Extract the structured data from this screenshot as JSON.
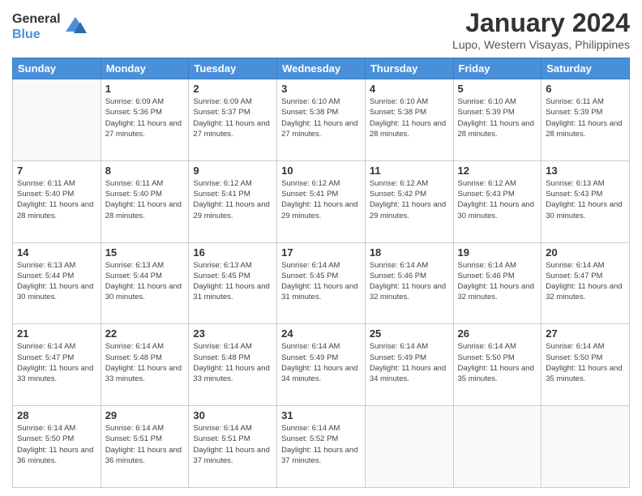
{
  "header": {
    "logo_line1": "General",
    "logo_line2": "Blue",
    "title": "January 2024",
    "subtitle": "Lupo, Western Visayas, Philippines"
  },
  "days_of_week": [
    "Sunday",
    "Monday",
    "Tuesday",
    "Wednesday",
    "Thursday",
    "Friday",
    "Saturday"
  ],
  "weeks": [
    [
      {
        "day": "",
        "sunrise": "",
        "sunset": "",
        "daylight": ""
      },
      {
        "day": "1",
        "sunrise": "6:09 AM",
        "sunset": "5:36 PM",
        "daylight": "11 hours and 27 minutes."
      },
      {
        "day": "2",
        "sunrise": "6:09 AM",
        "sunset": "5:37 PM",
        "daylight": "11 hours and 27 minutes."
      },
      {
        "day": "3",
        "sunrise": "6:10 AM",
        "sunset": "5:38 PM",
        "daylight": "11 hours and 27 minutes."
      },
      {
        "day": "4",
        "sunrise": "6:10 AM",
        "sunset": "5:38 PM",
        "daylight": "11 hours and 28 minutes."
      },
      {
        "day": "5",
        "sunrise": "6:10 AM",
        "sunset": "5:39 PM",
        "daylight": "11 hours and 28 minutes."
      },
      {
        "day": "6",
        "sunrise": "6:11 AM",
        "sunset": "5:39 PM",
        "daylight": "11 hours and 28 minutes."
      }
    ],
    [
      {
        "day": "7",
        "sunrise": "6:11 AM",
        "sunset": "5:40 PM",
        "daylight": "11 hours and 28 minutes."
      },
      {
        "day": "8",
        "sunrise": "6:11 AM",
        "sunset": "5:40 PM",
        "daylight": "11 hours and 28 minutes."
      },
      {
        "day": "9",
        "sunrise": "6:12 AM",
        "sunset": "5:41 PM",
        "daylight": "11 hours and 29 minutes."
      },
      {
        "day": "10",
        "sunrise": "6:12 AM",
        "sunset": "5:41 PM",
        "daylight": "11 hours and 29 minutes."
      },
      {
        "day": "11",
        "sunrise": "6:12 AM",
        "sunset": "5:42 PM",
        "daylight": "11 hours and 29 minutes."
      },
      {
        "day": "12",
        "sunrise": "6:12 AM",
        "sunset": "5:43 PM",
        "daylight": "11 hours and 30 minutes."
      },
      {
        "day": "13",
        "sunrise": "6:13 AM",
        "sunset": "5:43 PM",
        "daylight": "11 hours and 30 minutes."
      }
    ],
    [
      {
        "day": "14",
        "sunrise": "6:13 AM",
        "sunset": "5:44 PM",
        "daylight": "11 hours and 30 minutes."
      },
      {
        "day": "15",
        "sunrise": "6:13 AM",
        "sunset": "5:44 PM",
        "daylight": "11 hours and 30 minutes."
      },
      {
        "day": "16",
        "sunrise": "6:13 AM",
        "sunset": "5:45 PM",
        "daylight": "11 hours and 31 minutes."
      },
      {
        "day": "17",
        "sunrise": "6:14 AM",
        "sunset": "5:45 PM",
        "daylight": "11 hours and 31 minutes."
      },
      {
        "day": "18",
        "sunrise": "6:14 AM",
        "sunset": "5:46 PM",
        "daylight": "11 hours and 32 minutes."
      },
      {
        "day": "19",
        "sunrise": "6:14 AM",
        "sunset": "5:46 PM",
        "daylight": "11 hours and 32 minutes."
      },
      {
        "day": "20",
        "sunrise": "6:14 AM",
        "sunset": "5:47 PM",
        "daylight": "11 hours and 32 minutes."
      }
    ],
    [
      {
        "day": "21",
        "sunrise": "6:14 AM",
        "sunset": "5:47 PM",
        "daylight": "11 hours and 33 minutes."
      },
      {
        "day": "22",
        "sunrise": "6:14 AM",
        "sunset": "5:48 PM",
        "daylight": "11 hours and 33 minutes."
      },
      {
        "day": "23",
        "sunrise": "6:14 AM",
        "sunset": "5:48 PM",
        "daylight": "11 hours and 33 minutes."
      },
      {
        "day": "24",
        "sunrise": "6:14 AM",
        "sunset": "5:49 PM",
        "daylight": "11 hours and 34 minutes."
      },
      {
        "day": "25",
        "sunrise": "6:14 AM",
        "sunset": "5:49 PM",
        "daylight": "11 hours and 34 minutes."
      },
      {
        "day": "26",
        "sunrise": "6:14 AM",
        "sunset": "5:50 PM",
        "daylight": "11 hours and 35 minutes."
      },
      {
        "day": "27",
        "sunrise": "6:14 AM",
        "sunset": "5:50 PM",
        "daylight": "11 hours and 35 minutes."
      }
    ],
    [
      {
        "day": "28",
        "sunrise": "6:14 AM",
        "sunset": "5:50 PM",
        "daylight": "11 hours and 36 minutes."
      },
      {
        "day": "29",
        "sunrise": "6:14 AM",
        "sunset": "5:51 PM",
        "daylight": "11 hours and 36 minutes."
      },
      {
        "day": "30",
        "sunrise": "6:14 AM",
        "sunset": "5:51 PM",
        "daylight": "11 hours and 37 minutes."
      },
      {
        "day": "31",
        "sunrise": "6:14 AM",
        "sunset": "5:52 PM",
        "daylight": "11 hours and 37 minutes."
      },
      {
        "day": "",
        "sunrise": "",
        "sunset": "",
        "daylight": ""
      },
      {
        "day": "",
        "sunrise": "",
        "sunset": "",
        "daylight": ""
      },
      {
        "day": "",
        "sunrise": "",
        "sunset": "",
        "daylight": ""
      }
    ]
  ],
  "labels": {
    "sunrise_prefix": "Sunrise: ",
    "sunset_prefix": "Sunset: ",
    "daylight_prefix": "Daylight: "
  }
}
